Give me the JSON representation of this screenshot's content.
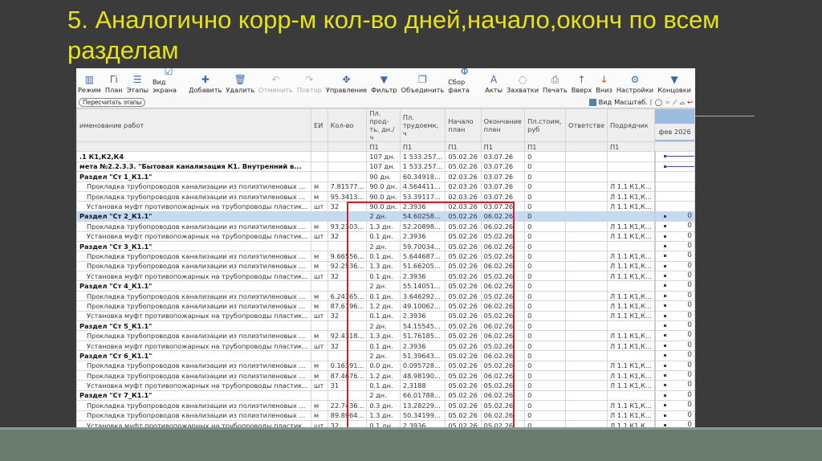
{
  "slide": {
    "title": "5. Аналогично корр-м кол-во дней,начало,оконч по всем разделам"
  },
  "toolbar": [
    {
      "label": "Режим",
      "icon": "mode-icon",
      "glyph": "▥"
    },
    {
      "label": "План",
      "icon": "plan-icon",
      "glyph": "Γi"
    },
    {
      "label": "Этапы",
      "icon": "stages-icon",
      "glyph": "☰"
    },
    {
      "label": "Вид экрана",
      "icon": "checklist-icon",
      "glyph": "☑"
    },
    {
      "label": "Добавить",
      "icon": "add-icon",
      "glyph": "✚"
    },
    {
      "label": "Удалить",
      "icon": "trash-icon",
      "glyph": "🗑"
    },
    {
      "label": "Отменить",
      "icon": "undo-icon",
      "glyph": "↶",
      "disabled": true
    },
    {
      "label": "Повтор",
      "icon": "redo-icon",
      "glyph": "↷",
      "disabled": true
    },
    {
      "label": "Управление",
      "icon": "move-icon",
      "glyph": "✥"
    },
    {
      "label": "Фильтр",
      "icon": "filter-icon",
      "glyph": "▼"
    },
    {
      "label": "Объединить",
      "icon": "merge-icon",
      "glyph": "❐"
    },
    {
      "label": "Сбор факта",
      "icon": "fact-icon",
      "glyph": "Φ"
    },
    {
      "label": "Акты",
      "icon": "acts-icon",
      "glyph": "A"
    },
    {
      "label": "Захватки",
      "icon": "grips-icon",
      "glyph": "◌"
    },
    {
      "label": "Печать",
      "icon": "print-icon",
      "glyph": "⎙"
    },
    {
      "label": "Вверх",
      "icon": "arrow-up-icon",
      "glyph": "↑"
    },
    {
      "label": "Вниз",
      "icon": "arrow-down-icon",
      "glyph": "↓"
    },
    {
      "label": "Настройки",
      "icon": "settings-icon",
      "glyph": "⚙"
    },
    {
      "label": "Концовки",
      "icon": "endings-icon",
      "glyph": "▼"
    }
  ],
  "recalc_label": "Пересчитать этапы",
  "view_label": "Вид",
  "scale_label": "Масштаб.",
  "columns": [
    "именование работ",
    "ЕИ",
    "Кол-во",
    "Пл. прод-ть, дн./ч",
    "Пл. трудоемк, ч",
    "Начало план",
    "Окончание план",
    "Пл.стоим, руб",
    "Ответстве",
    "Подрядчик"
  ],
  "subheaders": [
    "",
    "",
    "",
    "П1",
    "П1",
    "П1",
    "П1",
    "П1",
    "",
    "П1"
  ],
  "gantt_month": "фев 2026",
  "rows": [
    {
      "c": [
        ".1 К1,К2,К4",
        "",
        "",
        "107 дн.",
        "1 533.257...",
        "05.02.26",
        "03.07.26",
        "0",
        "",
        ""
      ],
      "t": "b",
      "g": "L"
    },
    {
      "c": [
        "мета №2.2.3.3. \"Бытовая канализация К1. Внутренний в...",
        "",
        "",
        "107 дн.",
        "1 533.257...",
        "05.02.26",
        "03.07.26",
        "0",
        "",
        ""
      ],
      "t": "b",
      "g": "L"
    },
    {
      "c": [
        "Раздел \"Ст 1_К1.1\"",
        "",
        "",
        "90 дн.",
        "60.34918...",
        "02.03.26",
        "03.07.26",
        "0",
        "",
        ""
      ],
      "t": "b",
      "g": "R"
    },
    {
      "c": [
        "Прокладка трубопроводов канализации из полиэтиленовых ...",
        "м",
        "7.81577...",
        "90.0 дн.",
        "4.564411...",
        "02.03.26",
        "03.07.26",
        "0",
        "",
        "Л 1.1 К1,К..."
      ],
      "t": "i",
      "g": "D"
    },
    {
      "c": [
        "Прокладка трубопроводов канализации из полиэтиленовых ...",
        "м",
        "95.3413...",
        "90.0 дн.",
        "53.39117...",
        "02.03.26",
        "03.07.26",
        "0",
        "",
        "Л 1.1 К1,К..."
      ],
      "t": "i",
      "g": "D"
    },
    {
      "c": [
        "Установка муфт противопожарных на трубопроводы пластик...",
        "шт",
        "32",
        "90.0 дн.",
        "2.3936",
        "02.03.26",
        "03.07.26",
        "0",
        "",
        "Л 1.1 К1,К..."
      ],
      "t": "i",
      "g": "D"
    },
    {
      "c": [
        "Раздел \"Ст 2_К1.1\"",
        "",
        "",
        "2 дн.",
        "54.60258...",
        "05.02.26",
        "06.02.26",
        "0",
        "",
        ""
      ],
      "t": "b",
      "sel": true,
      "g": "0"
    },
    {
      "c": [
        "Прокладка трубопроводов канализации из полиэтиленовых ...",
        "м",
        "93.2303...",
        "1.3 дн.",
        "52.20898...",
        "05.02.26",
        "06.02.26",
        "0",
        "",
        "Л 1.1 К1,К..."
      ],
      "t": "i",
      "g": "0"
    },
    {
      "c": [
        "Установка муфт противопожарных на трубопроводы пластик...",
        "шт",
        "32",
        "0.1 дн.",
        "2.3936",
        "05.02.26",
        "05.02.26",
        "0",
        "",
        "Л 1.1 К1,К..."
      ],
      "t": "i",
      "g": "0"
    },
    {
      "c": [
        "Раздел \"Ст 3_К1.1\"",
        "",
        "",
        "2 дн.",
        "59.70034...",
        "05.02.26",
        "06.02.26",
        "0",
        "",
        ""
      ],
      "t": "b",
      "g": "0"
    },
    {
      "c": [
        "Прокладка трубопроводов канализации из полиэтиленовых ...",
        "м",
        "9.66556...",
        "0.1 дн.",
        "5.644687...",
        "05.02.26",
        "05.02.26",
        "0",
        "",
        "Л 1.1 К1,К..."
      ],
      "t": "i",
      "g": "0"
    },
    {
      "c": [
        "Прокладка трубопроводов канализации из полиэтиленовых ...",
        "м",
        "92.2536...",
        "1.3 дн.",
        "51.66205...",
        "05.02.26",
        "06.02.26",
        "0",
        "",
        "Л 1.1 К1,К..."
      ],
      "t": "i",
      "g": "0"
    },
    {
      "c": [
        "Установка муфт противопожарных на трубопроводы пластик...",
        "шт",
        "32",
        "0.1 дн.",
        "2.3936",
        "05.02.26",
        "05.02.26",
        "0",
        "",
        "Л 1.1 К1,К..."
      ],
      "t": "i",
      "g": "0"
    },
    {
      "c": [
        "Раздел \"Ст 4_К1.1\"",
        "",
        "",
        "2 дн.",
        "55.14051...",
        "05.02.26",
        "06.02.26",
        "0",
        "",
        ""
      ],
      "t": "b",
      "g": "0"
    },
    {
      "c": [
        "Прокладка трубопроводов канализации из полиэтиленовых ...",
        "м",
        "6.24365...",
        "0.1 дн.",
        "3.646292...",
        "05.02.26",
        "05.02.26",
        "0",
        "",
        "Л 1.1 К1,К..."
      ],
      "t": "i",
      "g": "0"
    },
    {
      "c": [
        "Прокладка трубопроводов канализации из полиэтиленовых ...",
        "м",
        "87.6796...",
        "1.2 дн.",
        "49.10062...",
        "05.02.26",
        "06.02.26",
        "0",
        "",
        "Л 1.1 К1,К..."
      ],
      "t": "i",
      "g": "0"
    },
    {
      "c": [
        "Установка муфт противопожарных на трубопроводы пластик...",
        "шт",
        "32",
        "0.1 дн.",
        "2.3936",
        "05.02.26",
        "05.02.26",
        "0",
        "",
        "Л 1.1 К1,К..."
      ],
      "t": "i",
      "g": "0"
    },
    {
      "c": [
        "Раздел \"Ст 5_К1.1\"",
        "",
        "",
        "2 дн.",
        "54.15545...",
        "05.02.26",
        "06.02.26",
        "0",
        "",
        ""
      ],
      "t": "b",
      "g": "0"
    },
    {
      "c": [
        "Прокладка трубопроводов канализации из полиэтиленовых ...",
        "м",
        "92.4318...",
        "1.3 дн.",
        "51.76185...",
        "05.02.26",
        "06.02.26",
        "0",
        "",
        "Л 1.1 К1,К..."
      ],
      "t": "i",
      "g": "0"
    },
    {
      "c": [
        "Установка муфт противопожарных на трубопроводы пластик...",
        "шт",
        "32",
        "0.1 дн.",
        "2.3936",
        "05.02.26",
        "05.02.26",
        "0",
        "",
        "Л 1.1 К1,К..."
      ],
      "t": "i",
      "g": "0"
    },
    {
      "c": [
        "Раздел \"Ст 6_К1.1\"",
        "",
        "",
        "2 дн.",
        "51.39643...",
        "05.02.26",
        "06.02.26",
        "0",
        "",
        ""
      ],
      "t": "b",
      "g": "0"
    },
    {
      "c": [
        "Прокладка трубопроводов канализации из полиэтиленовых ...",
        "м",
        "0.16391...",
        "0.0 дн.",
        "0.095728...",
        "05.02.26",
        "05.02.26",
        "0",
        "",
        "Л 1.1 К1,К..."
      ],
      "t": "i",
      "g": "0"
    },
    {
      "c": [
        "Прокладка трубопроводов канализации из полиэтиленовых ...",
        "м",
        "87.4676...",
        "1.2 дн.",
        "48.98190...",
        "05.02.26",
        "06.02.26",
        "0",
        "",
        "Л 1.1 К1,К..."
      ],
      "t": "i",
      "g": "0"
    },
    {
      "c": [
        "Установка муфт противопожарных на трубопроводы пластик...",
        "шт",
        "31",
        "0.1 дн.",
        "2.3188",
        "05.02.26",
        "05.02.26",
        "0",
        "",
        "Л 1.1 К1,К..."
      ],
      "t": "i",
      "g": "0"
    },
    {
      "c": [
        "Раздел \"Ст 7_К1.1\"",
        "",
        "",
        "2 дн.",
        "66.01788...",
        "05.02.26",
        "06.02.26",
        "0",
        "",
        ""
      ],
      "t": "b",
      "g": "0"
    },
    {
      "c": [
        "Прокладка трубопроводов канализации из полиэтиленовых ...",
        "м",
        "22.7436...",
        "0.3 дн.",
        "13.28229...",
        "05.02.26",
        "05.02.26",
        "0",
        "",
        "Л 1.1 К1,К..."
      ],
      "t": "i",
      "g": "0"
    },
    {
      "c": [
        "Прокладка трубопроводов канализации из полиэтиленовых ...",
        "м",
        "89.8964...",
        "1.3 дн.",
        "50.34199...",
        "05.02.26",
        "06.02.26",
        "0",
        "",
        "Л 1.1 К1,К..."
      ],
      "t": "i",
      "g": "0"
    },
    {
      "c": [
        "Установка муфт противопожарных на трубопроводы пластик...",
        "шт",
        "32",
        "0.1 дн.",
        "2.3936",
        "05.02.26",
        "05.02.26",
        "0",
        "",
        "Л 1.1 К1,К..."
      ],
      "t": "i",
      "g": "0"
    }
  ],
  "colors": {
    "title": "#e6e21a",
    "highlight": "#d02030",
    "selected_row": "#c4daf0",
    "background": "#3b3b3b",
    "footer": "#6a7a6e"
  }
}
